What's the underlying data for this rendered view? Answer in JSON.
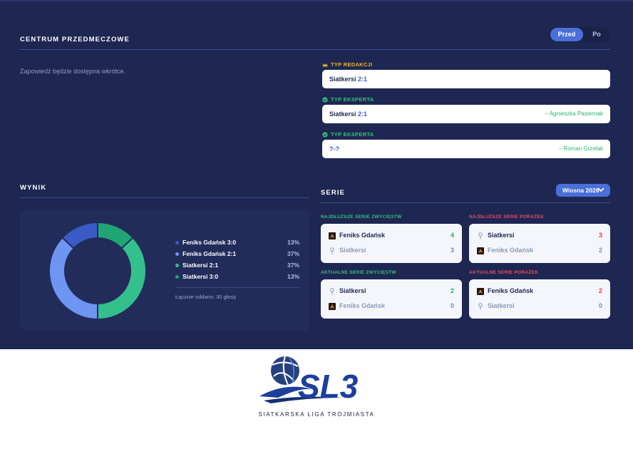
{
  "prematch": {
    "title": "CENTRUM PRZEDMECZOWE",
    "toggle": {
      "before": "Przed",
      "after": "Po",
      "active": "before"
    },
    "announcement": "Zapowiedź będzie dostępna wkrótce.",
    "tips": [
      {
        "label": "TYP REDAKCJI",
        "icon": "crown-icon",
        "team": "Siatkersi",
        "score": "2:1",
        "author": ""
      },
      {
        "label": "TYP EKSPERTA",
        "icon": "check-circle-icon",
        "team": "Siatkersi",
        "score": "2:1",
        "author": "– Agnieszka Pasternak"
      },
      {
        "label": "TYP EKSPERTA",
        "icon": "check-circle-icon",
        "team": "",
        "score": "?-?",
        "author": "– Roman Grzelak"
      }
    ]
  },
  "result": {
    "title": "WYNIK",
    "poll": [
      {
        "label": "Feniks Gdańsk 3:0",
        "percent": "13%",
        "share": 13,
        "color": "#3a5bc7"
      },
      {
        "label": "Feniks Gdańsk 2:1",
        "percent": "37%",
        "share": 37,
        "color": "#6e95f2"
      },
      {
        "label": "Siatkersi 2:1",
        "percent": "37%",
        "share": 37,
        "color": "#34c08c"
      },
      {
        "label": "Siatkersi 3:0",
        "percent": "13%",
        "share": 13,
        "color": "#1fa673"
      }
    ],
    "total": "Łącznie oddano: 30 głosy"
  },
  "series": {
    "title": "SERIE",
    "season": "Wiosna 2026",
    "blocks": [
      {
        "heading": "NAJDŁUŻSZE SERIE ZWYCIĘSTW",
        "tone": "g",
        "rows": [
          {
            "team": "Feniks Gdańsk",
            "logo": "feniks",
            "value": "4"
          },
          {
            "team": "Siatkersi",
            "logo": "siatkersi",
            "value": "3"
          }
        ]
      },
      {
        "heading": "NAJDŁUŻSZE SERIE PORAŻEK",
        "tone": "r",
        "rows": [
          {
            "team": "Siatkersi",
            "logo": "siatkersi",
            "value": "3"
          },
          {
            "team": "Feniks Gdańsk",
            "logo": "feniks",
            "value": "2"
          }
        ]
      },
      {
        "heading": "AKTUALNE SERIE ZWYCIĘSTW",
        "tone": "g",
        "rows": [
          {
            "team": "Siatkersi",
            "logo": "siatkersi",
            "value": "2"
          },
          {
            "team": "Feniks Gdańsk",
            "logo": "feniks",
            "value": "0"
          }
        ]
      },
      {
        "heading": "AKTUALNE SERIE PORAŻEK",
        "tone": "r",
        "rows": [
          {
            "team": "Feniks Gdańsk",
            "logo": "feniks",
            "value": "2"
          },
          {
            "team": "Siatkersi",
            "logo": "siatkersi",
            "value": "0"
          }
        ]
      }
    ]
  },
  "footer": {
    "logo_text": "SL3",
    "subtitle": "SIATKARSKA LIGA TRÓJMIASTA"
  },
  "colors": {
    "background": "#1e2752",
    "accent": "#4b6fd8",
    "win": "#27ae4f",
    "loss": "#e03a45"
  }
}
